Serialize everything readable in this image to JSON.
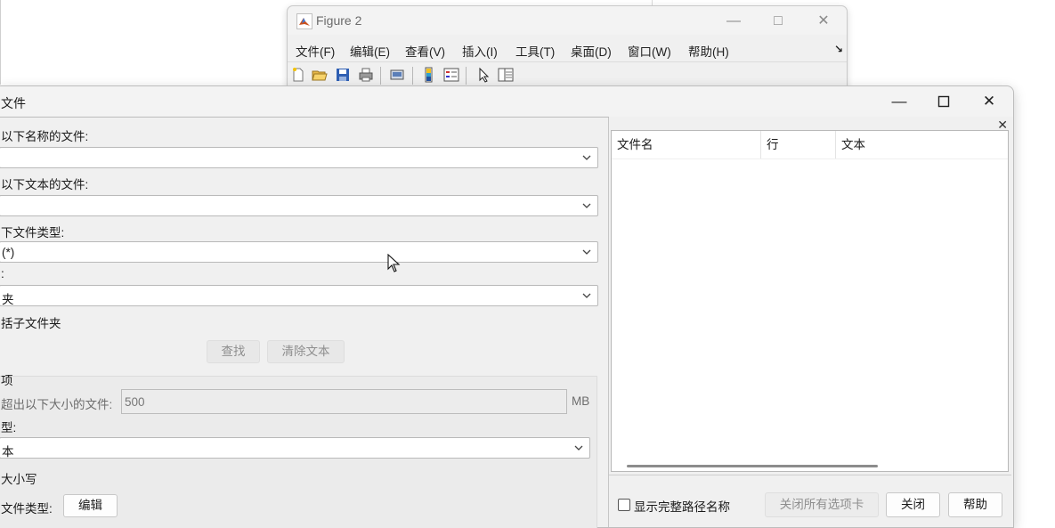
{
  "figure_window": {
    "title": "Figure 2",
    "menu": [
      "文件(F)",
      "编辑(E)",
      "查看(V)",
      "插入(I)",
      "工具(T)",
      "桌面(D)",
      "窗口(W)",
      "帮助(H)"
    ],
    "dock_glyph": "↘"
  },
  "find_window": {
    "title": "文件",
    "name_label": "以下名称的文件:",
    "name_value": "",
    "text_label": "以下文本的文件:",
    "text_value": "",
    "type_label": "下文件类型:",
    "type_value": "(*)",
    "location_label": ":",
    "location_value": "夹",
    "subfolders_label": "括子文件夹",
    "find_button": "查找",
    "clear_button": "清除文本",
    "options_header": "项",
    "size_label": "超出以下大小的文件:",
    "size_value": "500",
    "size_unit": "MB",
    "match_type_label": "型:",
    "match_type_value": "本",
    "case_label": "大小写",
    "filetypes_label": "文件类型:",
    "edit_button": "编辑"
  },
  "results": {
    "columns": [
      "文件名",
      "行",
      "文本"
    ],
    "rows": [],
    "show_full_path_label": "显示完整路径名称",
    "show_full_path_checked": false,
    "close_all_tabs_button": "关闭所有选项卡",
    "close_button": "关闭",
    "help_button": "帮助"
  }
}
